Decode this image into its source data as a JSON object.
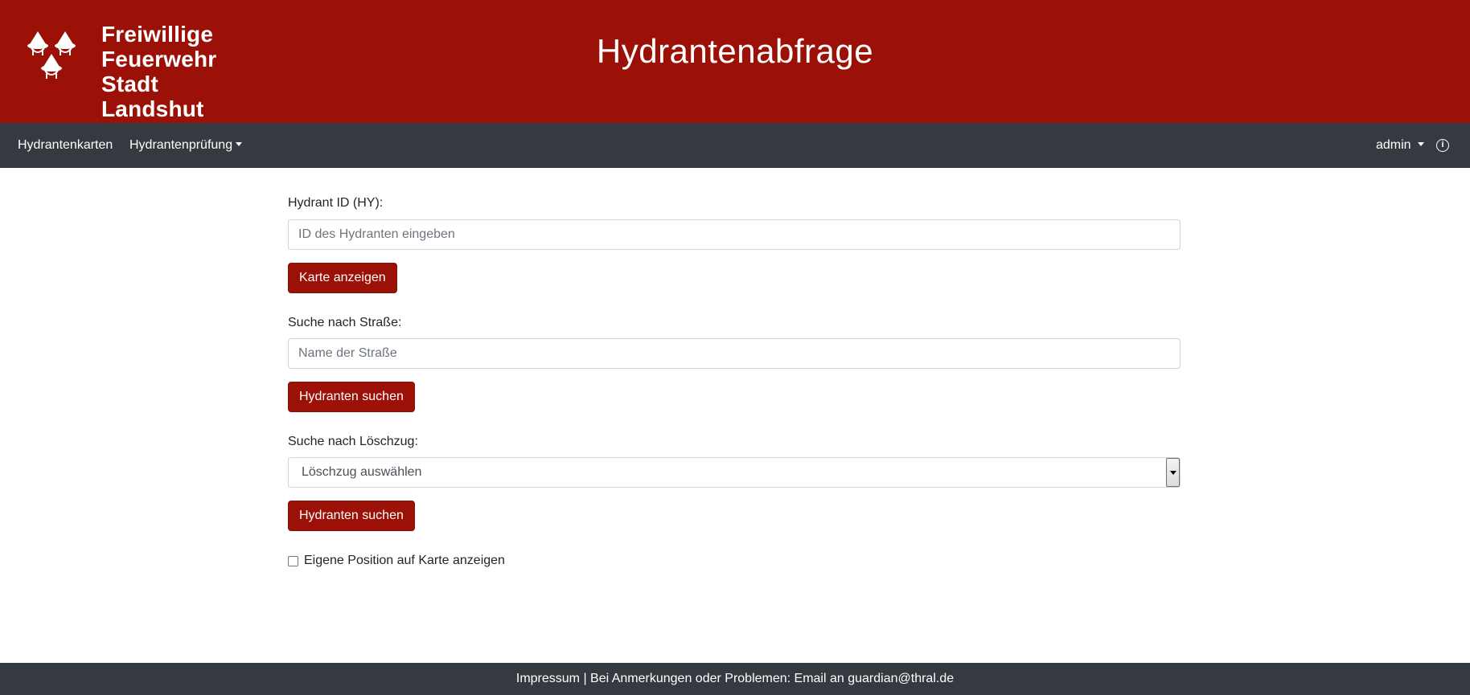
{
  "header": {
    "logo_lines": [
      "Freiwillige",
      "Feuerwehr",
      "Stadt Landshut"
    ],
    "title": "Hydrantenabfrage"
  },
  "nav": {
    "items": [
      {
        "label": "Hydrantenkarten"
      },
      {
        "label": "Hydrantenprüfung"
      }
    ],
    "user_label": "admin",
    "info_glyph": "i"
  },
  "form": {
    "id_section": {
      "label": "Hydrant ID (HY):",
      "placeholder": "ID des Hydranten eingeben",
      "value": "",
      "button": "Karte anzeigen"
    },
    "street_section": {
      "label": "Suche nach Straße:",
      "placeholder": "Name der Straße",
      "value": "",
      "button": "Hydranten suchen"
    },
    "zug_section": {
      "label": "Suche nach Löschzug:",
      "selected": "Löschzug auswählen",
      "button": "Hydranten suchen"
    },
    "position_checkbox": {
      "label": "Eigene Position auf Karte anzeigen",
      "checked": false
    }
  },
  "footer": {
    "impressum": "Impressum",
    "separator": " | ",
    "text": "Bei Anmerkungen oder Problemen: Email an guardian@thral.de"
  },
  "colors": {
    "brand_red": "#9b1107",
    "navbar": "#343a40"
  },
  "icons": {
    "logo": "fire-brigade-helmets-icon",
    "dropdown": "caret-down-icon",
    "info": "info-circle-icon"
  }
}
